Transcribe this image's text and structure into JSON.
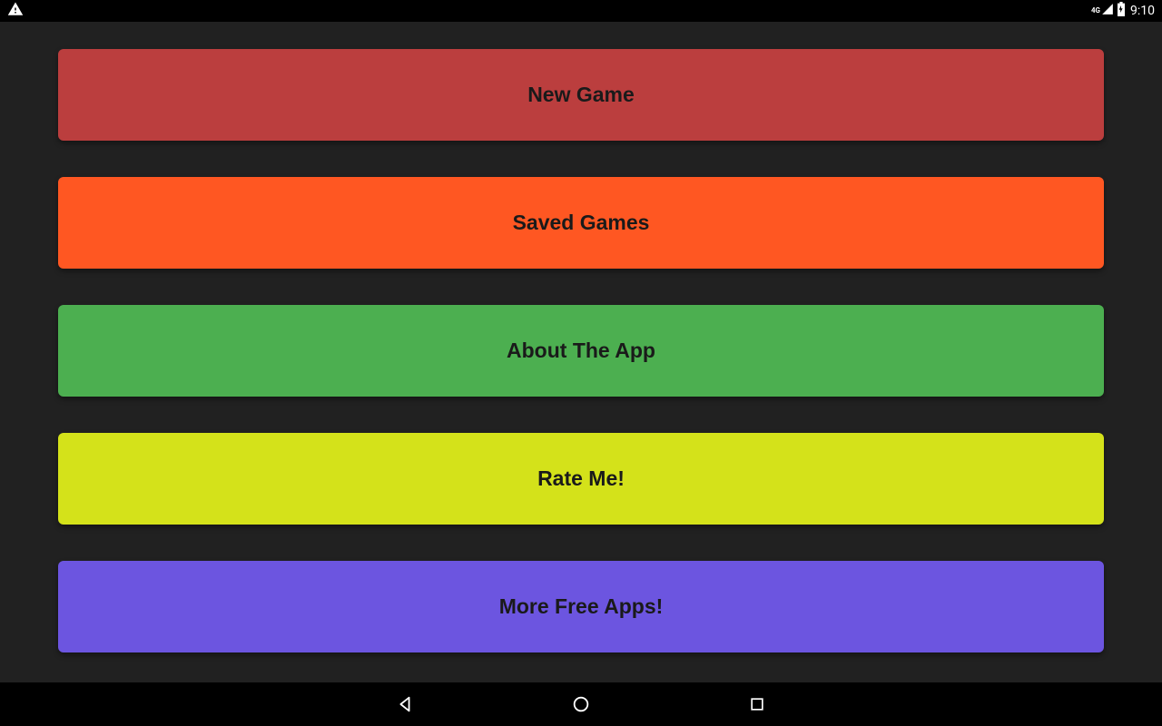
{
  "status_bar": {
    "network": "4G",
    "time": "9:10"
  },
  "menu": {
    "items": [
      {
        "label": "New Game",
        "color": "red"
      },
      {
        "label": "Saved Games",
        "color": "orange"
      },
      {
        "label": "About The App",
        "color": "green"
      },
      {
        "label": "Rate Me!",
        "color": "yellow"
      },
      {
        "label": "More Free Apps!",
        "color": "purple"
      }
    ]
  }
}
